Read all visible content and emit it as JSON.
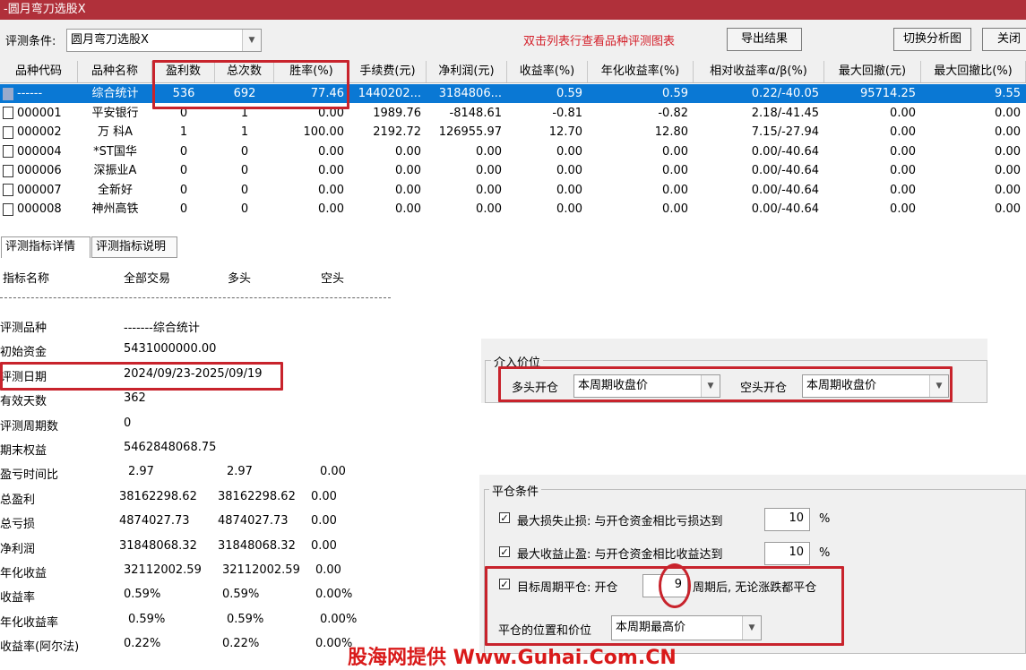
{
  "window": {
    "title": "-圆月弯刀选股X"
  },
  "toolbar": {
    "condition_label": "评测条件:",
    "condition_value": "圆月弯刀选股X",
    "hint": "双击列表行查看品种评测图表",
    "export_button": "导出结果",
    "switch_button": "切换分析图",
    "close_button": "关闭"
  },
  "grid": {
    "headers": [
      "品种代码",
      "品种名称",
      "盈利数",
      "总次数",
      "胜率(%)",
      "手续费(元)",
      "净利润(元)",
      "收益率(%)",
      "年化收益率(%)",
      "相对收益率α/β(%)",
      "最大回撤(元)",
      "最大回撤比(%)"
    ],
    "rows": [
      [
        "------",
        "综合统计",
        "536",
        "692",
        "77.46",
        "1440202...",
        "3184806...",
        "0.59",
        "0.59",
        "0.22/-40.05",
        "95714.25",
        "9.55"
      ],
      [
        "000001",
        "平安银行",
        "0",
        "1",
        "0.00",
        "1989.76",
        "-8148.61",
        "-0.81",
        "-0.82",
        "2.18/-41.45",
        "0.00",
        "0.00"
      ],
      [
        "000002",
        "万 科A",
        "1",
        "1",
        "100.00",
        "2192.72",
        "126955.97",
        "12.70",
        "12.80",
        "7.15/-27.94",
        "0.00",
        "0.00"
      ],
      [
        "000004",
        "*ST国华",
        "0",
        "0",
        "0.00",
        "0.00",
        "0.00",
        "0.00",
        "0.00",
        "0.00/-40.64",
        "0.00",
        "0.00"
      ],
      [
        "000006",
        "深振业A",
        "0",
        "0",
        "0.00",
        "0.00",
        "0.00",
        "0.00",
        "0.00",
        "0.00/-40.64",
        "0.00",
        "0.00"
      ],
      [
        "000007",
        "全新好",
        "0",
        "0",
        "0.00",
        "0.00",
        "0.00",
        "0.00",
        "0.00",
        "0.00/-40.64",
        "0.00",
        "0.00"
      ],
      [
        "000008",
        "神州高铁",
        "0",
        "0",
        "0.00",
        "0.00",
        "0.00",
        "0.00",
        "0.00",
        "0.00/-40.64",
        "0.00",
        "0.00"
      ]
    ]
  },
  "tabs": [
    "评测指标详情",
    "评测指标说明"
  ],
  "details": {
    "header": [
      "指标名称",
      "全部交易",
      "多头",
      "空头"
    ],
    "rows": [
      [
        "评测品种",
        "-------综合统计",
        "",
        ""
      ],
      [
        "初始资金",
        "5431000000.00",
        "",
        ""
      ],
      [
        "评测日期",
        "2024/09/23-2025/09/19",
        "",
        ""
      ],
      [
        "有效天数",
        "362",
        "",
        ""
      ],
      [
        "评测周期数",
        "0",
        "",
        ""
      ],
      [
        "期末权益",
        "5462848068.75",
        "",
        ""
      ],
      [
        "盈亏时间比",
        "2.97",
        "2.97",
        "0.00"
      ],
      [
        "总盈利",
        "38162298.62",
        "38162298.62",
        "0.00"
      ],
      [
        "总亏损",
        "4874027.73",
        "4874027.73",
        "0.00"
      ],
      [
        "净利润",
        "31848068.32",
        "31848068.32",
        "0.00"
      ],
      [
        "年化收益",
        "32112002.59",
        "32112002.59",
        "0.00"
      ],
      [
        "收益率",
        "0.59%",
        "0.59%",
        "0.00%"
      ],
      [
        "年化收益率",
        "0.59%",
        "0.59%",
        "0.00%"
      ],
      [
        "收益率(阿尔法)",
        "0.22%",
        "0.22%",
        "0.00%"
      ]
    ]
  },
  "entry_price": {
    "group_title": "介入价位",
    "long_label": "多头开仓",
    "long_value": "本周期收盘价",
    "short_label": "空头开仓",
    "short_value": "本周期收盘价"
  },
  "exit_conditions": {
    "group_title": "平仓条件",
    "stop_loss_label": "最大损失止损: 与开仓资金相比亏损达到",
    "stop_loss_value": "10",
    "take_profit_label": "最大收益止盈: 与开仓资金相比收益达到",
    "take_profit_value": "10",
    "percent": "%",
    "target_label": "目标周期平仓: 开仓",
    "target_value": "9",
    "target_suffix": "周期后, 无论涨跌都平仓",
    "position_label": "平仓的位置和价位",
    "position_value": "本周期最高价",
    "check_mark": "✓"
  },
  "watermark": "股海网提供 Www.Guhai.Com.CN",
  "colors": {
    "highlight": "#c8232c",
    "selection": "#0a78d4",
    "title_bar": "#b0303a",
    "hint": "#d4202a"
  }
}
